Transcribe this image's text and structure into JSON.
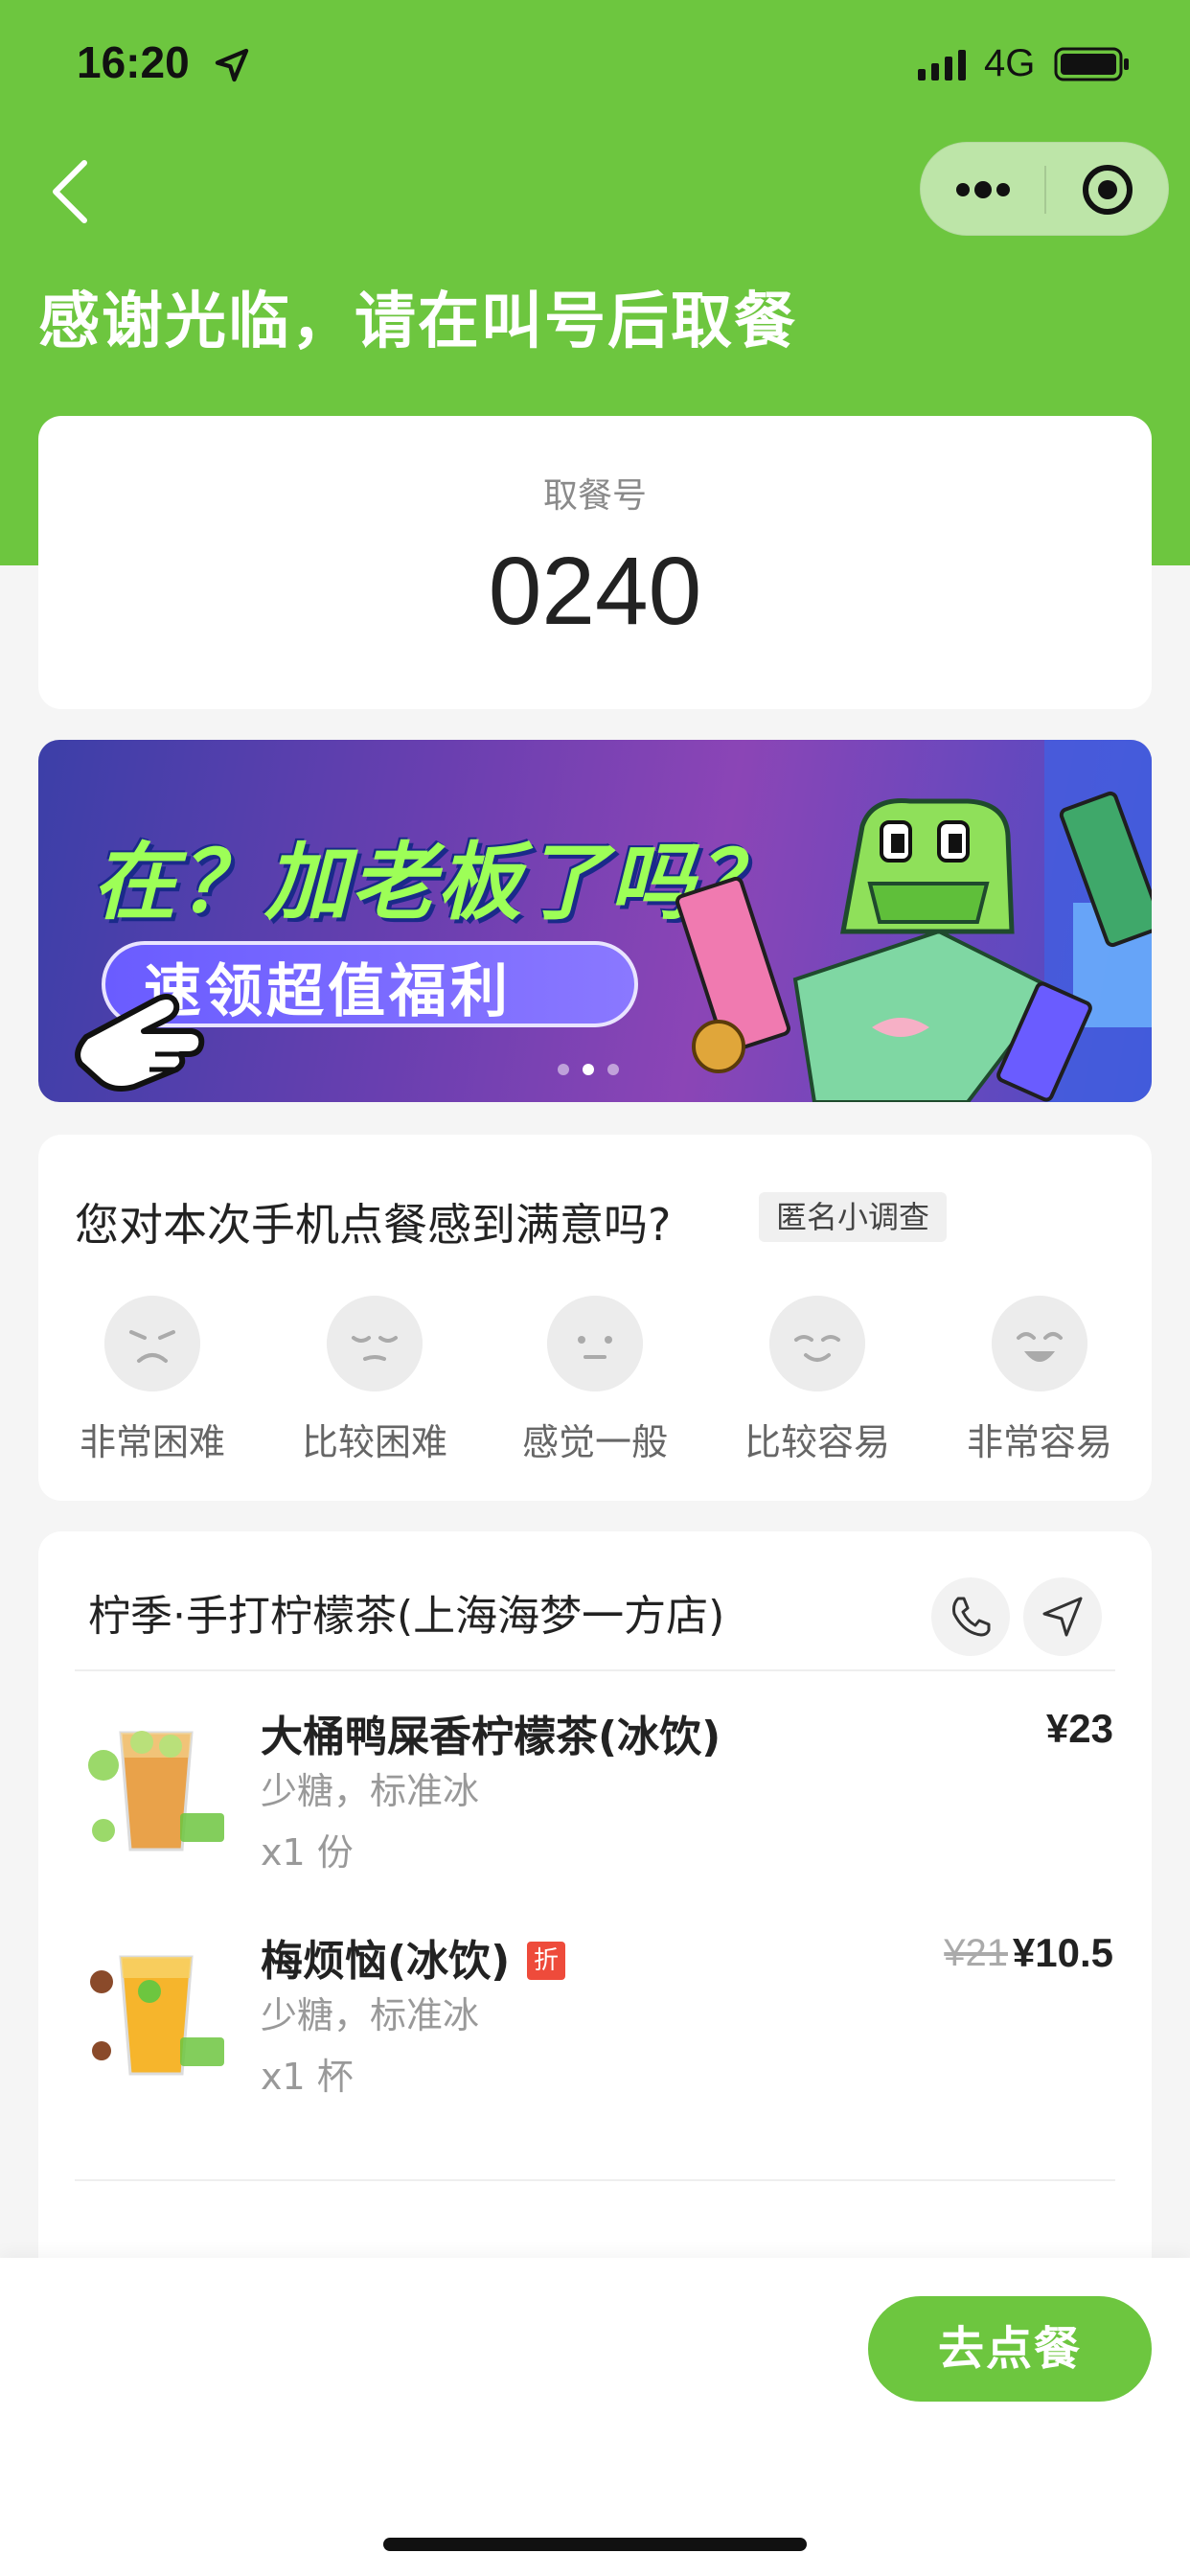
{
  "status_bar": {
    "time": "16:20",
    "network": "4G"
  },
  "header": {
    "title": "感谢光临，请在叫号后取餐"
  },
  "pickup": {
    "label": "取餐号",
    "number": "0240"
  },
  "banner": {
    "headline": "在？加老板了吗？",
    "cta": "速领超值福利",
    "page_count": 3,
    "active_index": 1
  },
  "survey": {
    "question": "您对本次手机点餐感到满意吗?",
    "tag": "匿名小调查",
    "options": [
      {
        "label": "非常困难",
        "icon": "very-difficult-face-icon"
      },
      {
        "label": "比较困难",
        "icon": "difficult-face-icon"
      },
      {
        "label": "感觉一般",
        "icon": "neutral-face-icon"
      },
      {
        "label": "比较容易",
        "icon": "easy-face-icon"
      },
      {
        "label": "非常容易",
        "icon": "very-easy-face-icon"
      }
    ]
  },
  "order": {
    "store_name": "柠季·手打柠檬茶(上海海梦一方店)",
    "items": [
      {
        "name": "大桶鸭屎香柠檬茶(冰饮)",
        "spec": "少糖，标准冰",
        "qty": "x1 份",
        "price": "¥23"
      },
      {
        "name": "梅烦恼(冰饮)",
        "badge": "折",
        "spec": "少糖，标准冰",
        "qty": "x1 杯",
        "original_price": "¥21",
        "price": "¥10.5"
      }
    ]
  },
  "footer": {
    "order_button": "去点餐"
  },
  "colors": {
    "brand_green": "#6dc63f",
    "discount_red": "#ee4b3b"
  }
}
